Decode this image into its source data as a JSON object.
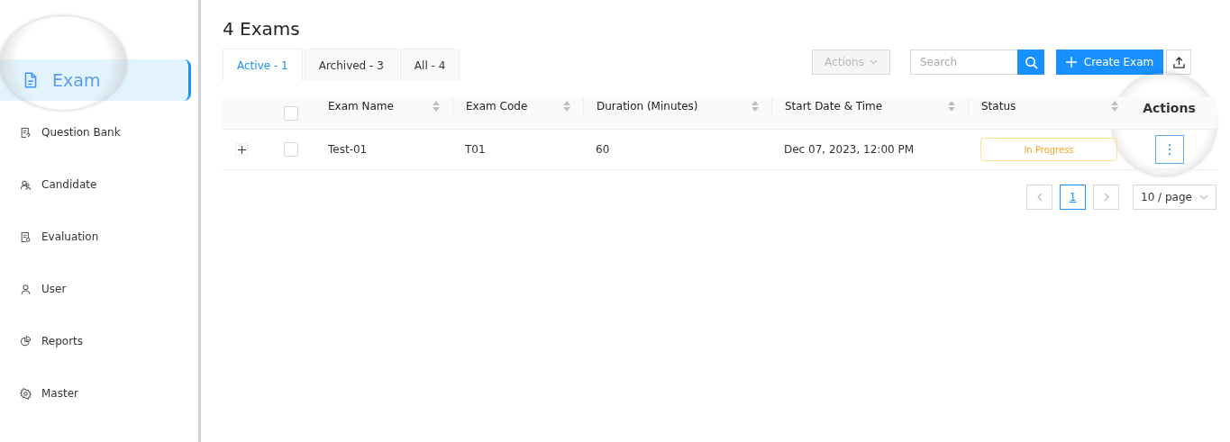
{
  "sidebar": {
    "items": [
      {
        "label": "Exam",
        "selected": true
      },
      {
        "label": "Question Bank",
        "selected": false
      },
      {
        "label": "Candidate",
        "selected": false
      },
      {
        "label": "Evaluation",
        "selected": false
      },
      {
        "label": "User",
        "selected": false
      },
      {
        "label": "Reports",
        "selected": false
      },
      {
        "label": "Master",
        "selected": false
      }
    ]
  },
  "page_title": "4 Exams",
  "tabs": [
    {
      "label": "Active - 1",
      "selected": true
    },
    {
      "label": "Archived - 3",
      "selected": false
    },
    {
      "label": "All - 4",
      "selected": false
    }
  ],
  "toolbar": {
    "actions_button": {
      "label": "Actions",
      "disabled": true
    },
    "search": {
      "placeholder": "Search"
    },
    "create_button": {
      "label": "Create Exam"
    }
  },
  "table": {
    "select_all": {
      "checked": false
    },
    "columns": [
      {
        "label": "Exam Name",
        "sortable": true
      },
      {
        "label": "Exam Code",
        "sortable": true
      },
      {
        "label": "Duration (Minutes)",
        "sortable": true
      },
      {
        "label": "Start Date & Time",
        "sortable": true
      },
      {
        "label": "Status",
        "sortable": true
      },
      {
        "label": "Actions",
        "sortable": false
      }
    ],
    "rows": [
      {
        "expanded": false,
        "checked": false,
        "cells": [
          "Test-01",
          "T01",
          "60",
          "Dec 07, 2023, 12:00 PM"
        ],
        "status": "In Progress"
      }
    ]
  },
  "pagination": {
    "pages": [
      {
        "label": "1",
        "selected": true
      }
    ],
    "page_size": "10 / page"
  }
}
